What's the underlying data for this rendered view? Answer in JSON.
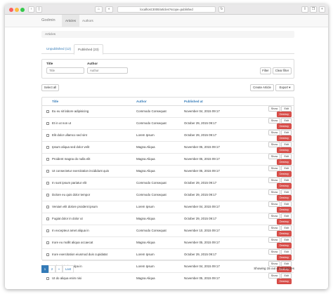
{
  "browser": {
    "url": "localhost:3000/articles?scope=published"
  },
  "nav": {
    "brand": "Godmin",
    "links": [
      "Articles",
      "Authors"
    ]
  },
  "breadcrumb": "Articles",
  "tabs": [
    "Unpublished (12)",
    "Published (23)"
  ],
  "filter": {
    "title_label": "Title",
    "title_placeholder": "Title",
    "author_label": "Author",
    "author_placeholder": "Author",
    "filter_button": "Filter",
    "clear_button": "Clear filter"
  },
  "actions": {
    "select_all": "Select all",
    "create": "Create Article",
    "export": "Export"
  },
  "table": {
    "columns": [
      "Title",
      "Author",
      "Published at"
    ],
    "row_buttons": [
      "Show",
      "Edit",
      "Destroy"
    ],
    "rows": [
      {
        "title": "Eu eu sit labore adipisicing",
        "author": "Commodo Consequat",
        "published": "November 04, 2015 09:17"
      },
      {
        "title": "Et in ut non ut",
        "author": "Commodo Consequat",
        "published": "October 29, 2015 09:17"
      },
      {
        "title": "Elit dolor ullamco sed sint",
        "author": "Lorem Ipsum",
        "published": "October 29, 2015 09:17"
      },
      {
        "title": "Ipsum aliqua sed dolor velit",
        "author": "Magna Aliqua",
        "published": "November 05, 2015 09:17"
      },
      {
        "title": "Proident magna do nulla elit",
        "author": "Magna Aliqua",
        "published": "November 05, 2015 09:17"
      },
      {
        "title": "Ut consectetur exercitation incididunt quis",
        "author": "Magna Aliqua",
        "published": "November 05, 2015 09:17"
      },
      {
        "title": "In sunt ipsum pariatur elit",
        "author": "Commodo Consequat",
        "published": "October 29, 2015 09:17"
      },
      {
        "title": "Dolore eu quis dolor tempor",
        "author": "Commodo Consequat",
        "published": "October 29, 2015 09:17"
      },
      {
        "title": "Veniam elit dolore proident ipsum",
        "author": "Lorem Ipsum",
        "published": "November 04, 2015 09:17"
      },
      {
        "title": "Fugiat dolor in dolor ut",
        "author": "Magna Aliqua",
        "published": "October 29, 2015 09:17"
      },
      {
        "title": "In excepteur amet aliqua in",
        "author": "Commodo Consequat",
        "published": "November 10, 2015 09:17"
      },
      {
        "title": "Irure eu mollit aliqua occaecat",
        "author": "Magna Aliqua",
        "published": "November 05, 2015 09:17"
      },
      {
        "title": "Irure exercitation eiusmod duis cupidatat",
        "author": "Lorem Ipsum",
        "published": "October 29, 2015 09:17"
      },
      {
        "title": "Dolor nisi sint culpa in",
        "author": "Lorem Ipsum",
        "published": "November 04, 2015 09:17"
      },
      {
        "title": "Ut do aliqua enim nisi",
        "author": "Magna Aliqua",
        "published": "November 05, 2015 09:17"
      }
    ]
  },
  "pagination": {
    "pages": [
      "1",
      "2",
      "»",
      "Last"
    ],
    "showing": "Showing 15 out of 23 articles"
  },
  "colors": {
    "primary": "#337ab7",
    "danger": "#d9534f"
  }
}
